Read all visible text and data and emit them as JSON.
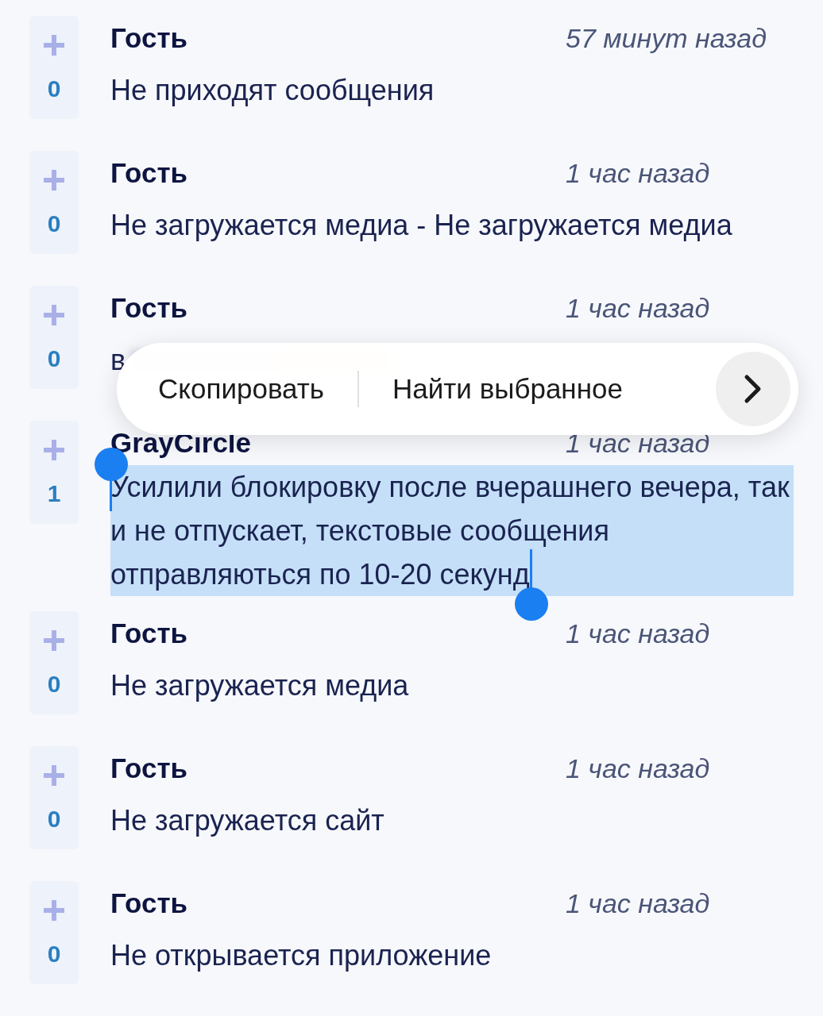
{
  "posts": [
    {
      "author": "Гость",
      "time": "57 минут назад",
      "votes": "0",
      "message": "Не приходят сообщения",
      "selected": false
    },
    {
      "author": "Гость",
      "time": "1 час назад",
      "votes": "0",
      "message": "Не загружается медиа - Не загружается медиа",
      "selected": false
    },
    {
      "author": "Гость",
      "time": "1 час назад",
      "votes": "0",
      "message": "в",
      "selected": false,
      "blurred": true
    },
    {
      "author": "GrayCircle",
      "time": "1 час назад",
      "votes": "1",
      "message": "Усилили блокировку после вчерашнего вечера, так и не отпускает, текстовые сообщения отправляються по 10-20 секунд",
      "selected": true
    },
    {
      "author": "Гость",
      "time": "1 час назад",
      "votes": "0",
      "message": "Не загружается медиа",
      "selected": false
    },
    {
      "author": "Гость",
      "time": "1 час назад",
      "votes": "0",
      "message": "Не загружается сайт",
      "selected": false
    },
    {
      "author": "Гость",
      "time": "1 час назад",
      "votes": "0",
      "message": "Не открывается приложение",
      "selected": false
    }
  ],
  "context_menu": {
    "items": [
      "Скопировать",
      "Найти выбранное"
    ],
    "more": true
  }
}
